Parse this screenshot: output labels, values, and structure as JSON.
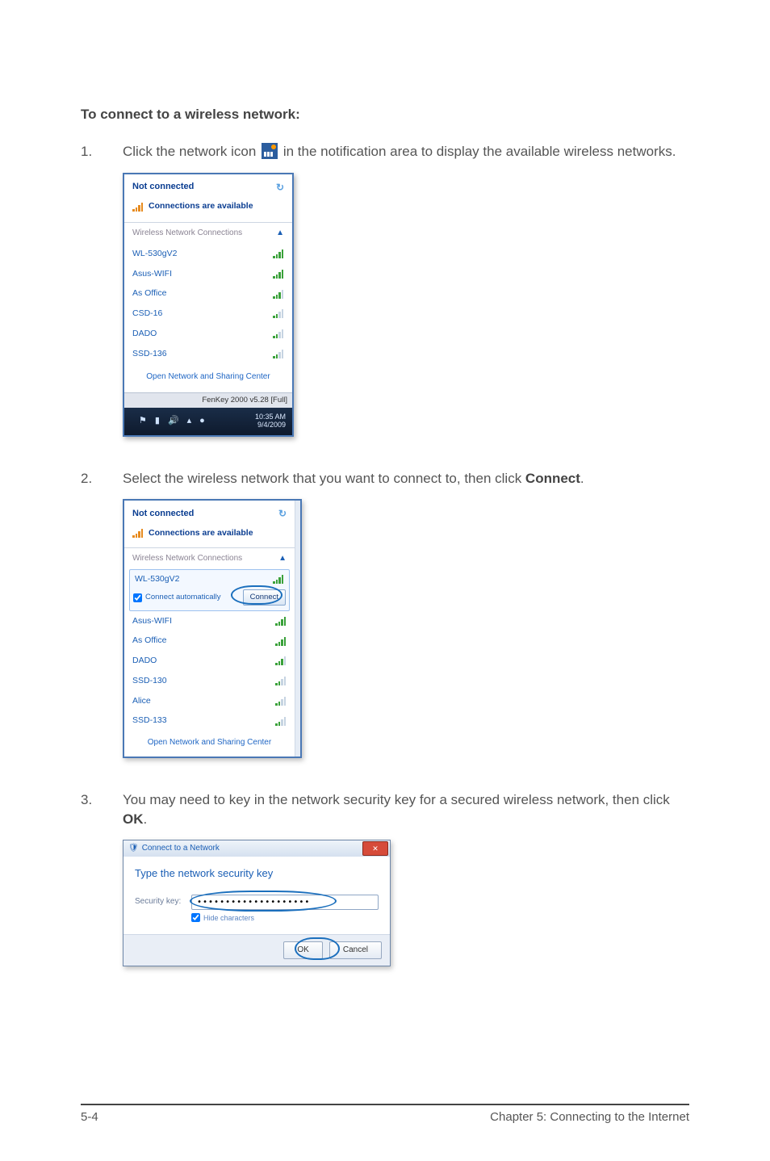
{
  "heading": "To connect to a wireless network:",
  "steps": {
    "s1": {
      "num": "1.",
      "before": "Click the network icon ",
      "after": " in the notification area to display the available wireless networks."
    },
    "s2": {
      "num": "2.",
      "textA": "Select the wireless network that you want to connect to, then click ",
      "bold": "Connect",
      "textB": "."
    },
    "s3": {
      "num": "3.",
      "textA": "You may need to key in the network security key for a secured wireless network, then click ",
      "bold": "OK",
      "textB": "."
    }
  },
  "panel1": {
    "status": "Not connected",
    "available": "Connections are available",
    "section": "Wireless Network Connections",
    "items": [
      {
        "name": "WL-530gV2"
      },
      {
        "name": "Asus-WIFI"
      },
      {
        "name": "As Office"
      },
      {
        "name": "CSD-16"
      },
      {
        "name": "DADO"
      },
      {
        "name": "SSD-136"
      }
    ],
    "link": "Open Network and Sharing Center",
    "ime": "FenKey 2000 v5.28 [Full]",
    "clock_time": "10:35 AM",
    "clock_date": "9/4/2009"
  },
  "panel2": {
    "status": "Not connected",
    "available": "Connections are available",
    "section": "Wireless Network Connections",
    "selected": "WL-530gV2",
    "auto": "Connect automatically",
    "connect": "Connect",
    "items": [
      {
        "name": "Asus-WIFI"
      },
      {
        "name": "As Office"
      },
      {
        "name": "DADO"
      },
      {
        "name": "SSD-130"
      },
      {
        "name": "Alice"
      },
      {
        "name": "SSD-133"
      }
    ],
    "link": "Open Network and Sharing Center"
  },
  "panel3": {
    "title": "Connect to a Network",
    "head": "Type the network security key",
    "label": "Security key:",
    "value": "••••••••••••••••••••",
    "hide": "Hide characters",
    "ok": "OK",
    "cancel": "Cancel"
  },
  "footer": {
    "left": "5-4",
    "right": "Chapter 5: Connecting to the Internet"
  }
}
